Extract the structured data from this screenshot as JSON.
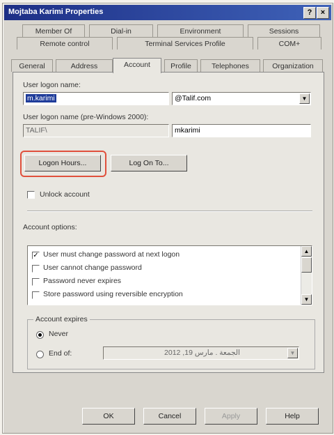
{
  "window": {
    "title": "Mojtaba Karimi Properties",
    "help_btn": "?",
    "close_btn": "×"
  },
  "tabs": {
    "row1": [
      "Member Of",
      "Dial-in",
      "Environment",
      "Sessions"
    ],
    "row2": [
      "Remote control",
      "Terminal Services Profile",
      "COM+"
    ],
    "row3": [
      "General",
      "Address",
      "Account",
      "Profile",
      "Telephones",
      "Organization"
    ],
    "active": "Account"
  },
  "account": {
    "logon_name_label": "User logon name:",
    "logon_name_value": "m.karimi",
    "domain_value": "@Talif.com",
    "pre2000_label": "User logon name (pre-Windows 2000):",
    "pre2000_domain": "TALIF\\",
    "pre2000_value": "mkarimi",
    "logon_hours_btn": "Logon Hours...",
    "log_on_to_btn": "Log On To...",
    "unlock_label": "Unlock account",
    "options_label": "Account options:",
    "options": [
      {
        "label": "User must change password at next logon",
        "checked": true
      },
      {
        "label": "User cannot change password",
        "checked": false
      },
      {
        "label": "Password never expires",
        "checked": false
      },
      {
        "label": "Store password using reversible encryption",
        "checked": false
      }
    ],
    "expires_label": "Account expires",
    "never_label": "Never",
    "end_of_label": "End of:",
    "end_of_date": "الجمعة . مارس 19, 2012",
    "expires_selected": "never"
  },
  "footer": {
    "ok": "OK",
    "cancel": "Cancel",
    "apply": "Apply",
    "help": "Help"
  },
  "colors": {
    "title_bar": "#1d2f86",
    "highlight": "#e0503c",
    "selection": "#1f3c9a"
  }
}
